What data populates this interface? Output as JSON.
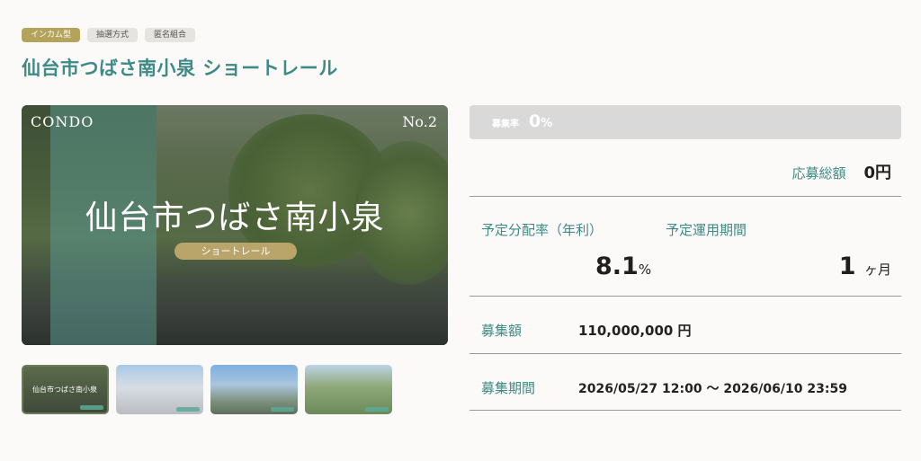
{
  "tags": [
    "インカム型",
    "抽選方式",
    "匿名組合"
  ],
  "page_title": "仙台市つばさ南小泉 ショートレール",
  "hero": {
    "corner_left": "CONDO",
    "corner_right": "No.2",
    "name": "仙台市つばさ南小泉",
    "pill": "ショートレール"
  },
  "thumbnails": [
    {
      "caption": "仙台市つばさ南小泉",
      "kind": "cover"
    },
    {
      "kind": "building-photo"
    },
    {
      "kind": "city-photo"
    },
    {
      "kind": "park-photo"
    }
  ],
  "funding_rate": {
    "label": "募集率",
    "value": "0",
    "unit": "%"
  },
  "total_applied": {
    "label": "応募総額",
    "value": "0円"
  },
  "distribution": {
    "label": "予定分配率（年利）",
    "value": "8.1",
    "unit": "%"
  },
  "period": {
    "label": "予定運用期間",
    "value": "1",
    "unit": "ヶ月"
  },
  "amount": {
    "label": "募集額",
    "value": "110,000,000 円"
  },
  "recruit_period": {
    "label": "募集期間",
    "value": "2026/05/27 12:00 〜 2026/06/10 23:59"
  },
  "colors": {
    "accent": "#3d8a86",
    "tag_primary": "#b3a35b",
    "pill": "#b9a56a",
    "rate_bar": "#d9d9d9"
  }
}
